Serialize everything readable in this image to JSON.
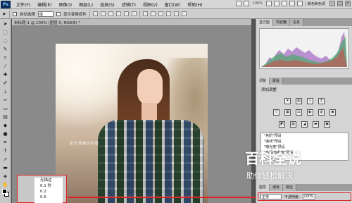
{
  "app": {
    "logo": "Ps"
  },
  "menu": [
    "文件(F)",
    "编辑(E)",
    "图像(I)",
    "图层(L)",
    "选择(S)",
    "滤镜(T)",
    "视图(V)",
    "窗口(W)",
    "帮助(H)"
  ],
  "menu_right": {
    "zoom": "100%",
    "workspace": "颜色和色调"
  },
  "options": {
    "auto_select": "自动选择",
    "group_value": "组",
    "show_transform": "显示变换控件"
  },
  "document": {
    "tab_title": "未标题-1 @ 100% (图层 0, RGB/8) *"
  },
  "photo": {
    "caption": "阳光洒满你的脸"
  },
  "dropdown": {
    "items": [
      "无描边",
      "0.1 秒",
      "0.2",
      "0.5"
    ]
  },
  "panels": {
    "top_tabs": [
      "直方图",
      "导航器",
      "信息"
    ],
    "adjust_tabs": [
      "调整",
      "蒙版"
    ],
    "adjust_title": "添加调整",
    "presets": [
      "\"色阶\"预设",
      "\"曲线\"预设",
      "\"曝光度\"预设",
      "\"色相/饱和度\"预设",
      "\"黑白\"预设"
    ],
    "layer_tabs": [
      "图层",
      "通道",
      "路径"
    ],
    "blend_mode": "正常",
    "opacity_label": "不透明度:",
    "opacity_value": "100%"
  },
  "watermark": {
    "title": "百科全说",
    "subtitle": "助你轻松解决"
  }
}
